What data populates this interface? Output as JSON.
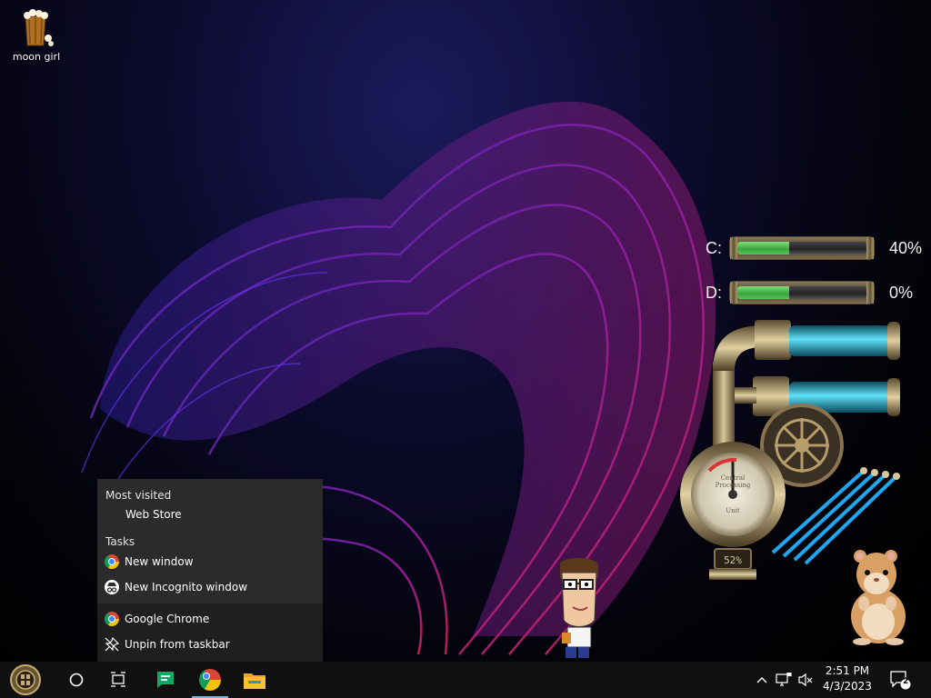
{
  "desktop": {
    "icons": [
      {
        "label": "moon girl",
        "icon": "popcorn-bag-icon"
      }
    ]
  },
  "widgets": {
    "drives": [
      {
        "letter": "C:",
        "percent_label": "40%",
        "fill_fraction": 0.4
      },
      {
        "letter": "D:",
        "percent_label": "0%",
        "fill_fraction": 0.4
      }
    ],
    "gauge": {
      "readout": "52%",
      "dial_text_1": "Central",
      "dial_text_2": "Processing",
      "dial_text_3": "Unit"
    }
  },
  "jumplist": {
    "most_visited_header": "Most visited",
    "most_visited": [
      {
        "label": "Web Store"
      }
    ],
    "tasks_header": "Tasks",
    "tasks": [
      {
        "label": "New window",
        "icon": "chrome-icon"
      },
      {
        "label": "New Incognito window",
        "icon": "incognito-icon"
      }
    ],
    "app": {
      "label": "Google Chrome",
      "icon": "chrome-icon"
    },
    "unpin": {
      "label": "Unpin from taskbar",
      "icon": "unpin-icon"
    }
  },
  "taskbar": {
    "start_icon": "steampunk-start-icon",
    "search_icon": "cortana-circle-icon",
    "taskview_icon": "task-view-icon",
    "pinned": [
      {
        "name": "google-chat-icon",
        "color": "#16a765"
      },
      {
        "name": "chrome-icon",
        "color": "#4285f4"
      },
      {
        "name": "file-explorer-icon",
        "color": "#f8c13a"
      }
    ],
    "tray": {
      "time": "2:51 PM",
      "date": "4/3/2023",
      "notification_count": "2"
    }
  }
}
